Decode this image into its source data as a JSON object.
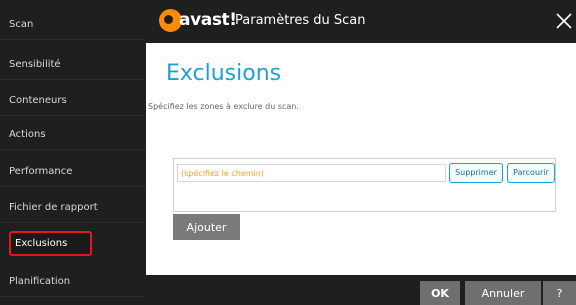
{
  "sidebar": {
    "items": [
      {
        "label": "Scan"
      },
      {
        "label": "Sensibilité"
      },
      {
        "label": "Conteneurs"
      },
      {
        "label": "Actions"
      },
      {
        "label": "Performance"
      },
      {
        "label": "Fichier de rapport"
      },
      {
        "label": "Exclusions",
        "active": true
      },
      {
        "label": "Planification"
      }
    ]
  },
  "header": {
    "logo_text": "avast!",
    "title": "Paramètres du Scan",
    "close_icon": "close-icon"
  },
  "main": {
    "title": "Exclusions",
    "description": "Spécifiez les zones à exclure du scan.",
    "path_input": {
      "value": "",
      "placeholder": "(spécifiez le chemin)"
    },
    "delete_label": "Supprimer",
    "browse_label": "Parcourir",
    "add_label": "Ajouter"
  },
  "footer": {
    "ok_label": "OK",
    "cancel_label": "Annuler",
    "help_label": "?"
  },
  "colors": {
    "accent": "#1ea0d7",
    "logo_orange": "#ff8a00",
    "active_outline": "#e0181b",
    "placeholder": "#f0a531",
    "dark_bg": "#1f1f1f"
  }
}
